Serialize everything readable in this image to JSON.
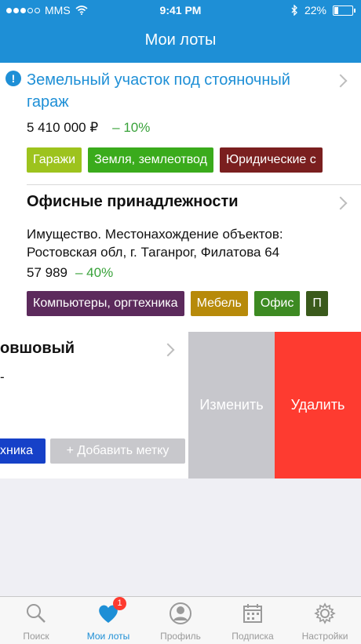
{
  "status_bar": {
    "carrier": "MMS",
    "time": "9:41 PM",
    "battery": "22%"
  },
  "nav": {
    "title": "Мои лоты"
  },
  "lots": [
    {
      "title": "Земельный участок под стояночный гараж",
      "price": "5 410 000 ₽",
      "discount": "– 10%",
      "tags": [
        {
          "label": "Гаражи",
          "color": "#9dc31d"
        },
        {
          "label": "Земля, землеотвод",
          "color": "#3aab1c"
        },
        {
          "label": "Юридические с",
          "color": "#7a1f1f"
        }
      ]
    },
    {
      "title": "Офисные принадлежности",
      "description": "Имущество. Местонахождение объектов: Ростовская обл, г. Таганрог, Филатова 64",
      "price": "57 989",
      "discount": "– 40%",
      "tags": [
        {
          "label": "Компьютеры, оргтехника",
          "color": "#5c2a5c"
        },
        {
          "label": "Мебель",
          "color": "#b78a0a"
        },
        {
          "label": "Офис",
          "color": "#3d8a22"
        },
        {
          "label": "П",
          "color": "#3a5a1c"
        }
      ]
    },
    {
      "title": "овшовый",
      "stub": "-",
      "tag": {
        "label": "хника",
        "color": "#1641c8"
      },
      "add_tag_label": "+ Добавить метку",
      "swipe_actions": {
        "edit": "Изменить",
        "delete": "Удалить"
      }
    }
  ],
  "tabbar": {
    "items": [
      {
        "label": "Поиск",
        "icon": "search-icon"
      },
      {
        "label": "Мои лоты",
        "icon": "heart-icon",
        "badge": "1",
        "active": true
      },
      {
        "label": "Профиль",
        "icon": "profile-icon"
      },
      {
        "label": "Подписка",
        "icon": "calendar-icon"
      },
      {
        "label": "Настройки",
        "icon": "gear-icon"
      }
    ]
  },
  "colors": {
    "accent": "#1e8fd6",
    "discount": "#39a23a",
    "delete": "#fe3b30",
    "edit": "#c7c7cc"
  }
}
